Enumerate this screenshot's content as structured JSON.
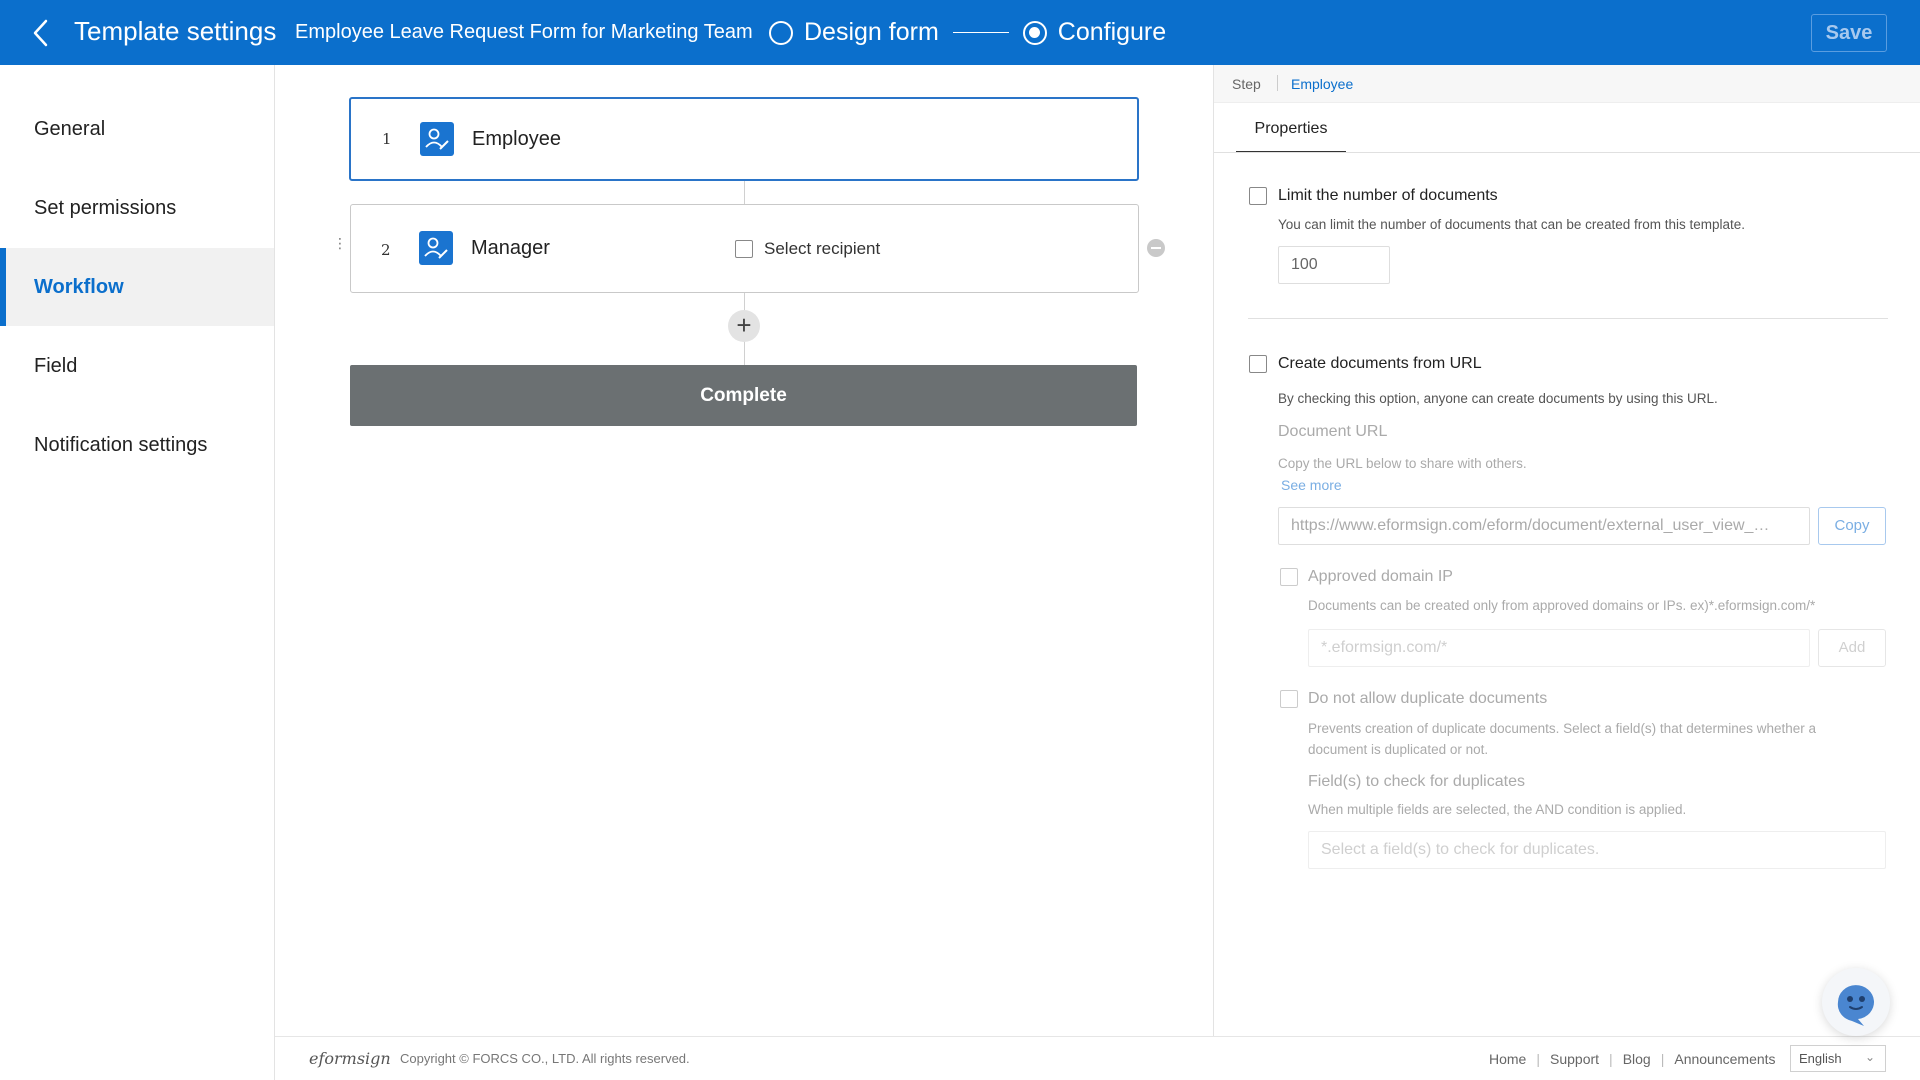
{
  "header": {
    "title": "Template settings",
    "form_name": "Employee Leave Request Form for Marketing Team",
    "steps": [
      {
        "label": "Design form",
        "active": false
      },
      {
        "label": "Configure",
        "active": true
      }
    ],
    "save_label": "Save",
    "bg_color": "#0b6fcc"
  },
  "sidebar": {
    "items": [
      {
        "label": "General",
        "active": false
      },
      {
        "label": "Set permissions",
        "active": false
      },
      {
        "label": "Workflow",
        "active": true
      },
      {
        "label": "Field",
        "active": false
      },
      {
        "label": "Notification settings",
        "active": false
      }
    ]
  },
  "workflow": {
    "steps": [
      {
        "number": "1",
        "name": "Employee",
        "selected": true,
        "icon": "user-sign-icon"
      },
      {
        "number": "2",
        "name": "Manager",
        "selected": false,
        "icon": "user-sign-icon",
        "checkbox_label": "Select recipient"
      }
    ],
    "complete_label": "Complete"
  },
  "panel": {
    "breadcrumb": {
      "step": "Step",
      "current": "Employee"
    },
    "tab": "Properties",
    "limit": {
      "title": "Limit the number of documents",
      "desc": "You can limit the number of documents that can be created from this template.",
      "value": "100"
    },
    "url": {
      "title": "Create documents from URL",
      "desc": "By checking this option, anyone can create documents by using this URL.",
      "doc_url_label": "Document URL",
      "doc_url_desc": "Copy the URL below to share with others.",
      "see_more": "See more",
      "url_value": "https://www.eformsign.com/eform/document/external_user_view_…",
      "copy_label": "Copy",
      "approved": {
        "title": "Approved domain IP",
        "desc": "Documents can be created only from approved domains or IPs. ex)*.eformsign.com/*",
        "placeholder": "*.eformsign.com/*",
        "add_label": "Add"
      },
      "duplicate": {
        "title": "Do not allow duplicate documents",
        "desc_line1": "Prevents creation of duplicate documents. Select a field(s) that determines whether a",
        "desc_line2": "document is duplicated or not.",
        "fields_label": "Field(s) to check for duplicates",
        "fields_desc": "When multiple fields are selected, the AND condition is applied.",
        "placeholder": "Select a field(s) to check for duplicates."
      }
    }
  },
  "footer": {
    "logo": "eformsign",
    "copyright": "Copyright © FORCS CO., LTD. All rights reserved.",
    "links": [
      "Home",
      "Support",
      "Blog",
      "Announcements"
    ],
    "language": "English"
  }
}
